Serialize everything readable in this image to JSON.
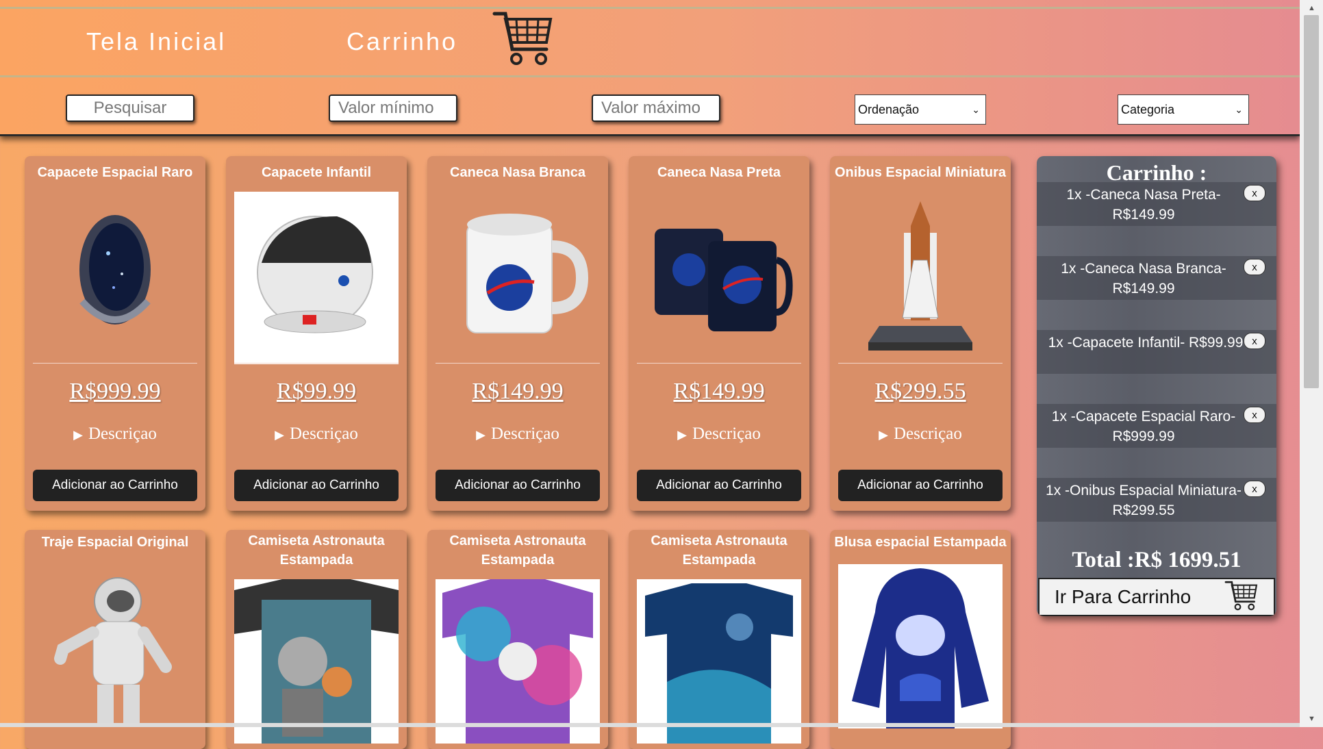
{
  "nav": {
    "home_label": "Tela Inicial",
    "cart_label": "Carrinho"
  },
  "filters": {
    "search_placeholder": "Pesquisar",
    "min_placeholder": "Valor mínimo",
    "max_placeholder": "Valor máximo",
    "sort_selected": "Ordenação",
    "category_selected": "Categoria"
  },
  "products": [
    {
      "name": "Capacete Espacial Raro",
      "price": "R$999.99",
      "description_label": "Descriçao",
      "button_label": "Adicionar ao Carrinho"
    },
    {
      "name": "Capacete Infantil",
      "price": "R$99.99",
      "description_label": "Descriçao",
      "button_label": "Adicionar ao Carrinho"
    },
    {
      "name": "Caneca Nasa Branca",
      "price": "R$149.99",
      "description_label": "Descriçao",
      "button_label": "Adicionar ao Carrinho"
    },
    {
      "name": "Caneca Nasa Preta",
      "price": "R$149.99",
      "description_label": "Descriçao",
      "button_label": "Adicionar ao Carrinho"
    },
    {
      "name": "Onibus Espacial Miniatura",
      "price": "R$299.55",
      "description_label": "Descriçao",
      "button_label": "Adicionar ao Carrinho"
    }
  ],
  "products_row2": [
    {
      "name": "Traje Espacial Original"
    },
    {
      "name": "Camiseta Astronauta Estampada"
    },
    {
      "name": "Camiseta Astronauta Estampada"
    },
    {
      "name": "Camiseta Astronauta Estampada"
    },
    {
      "name": "Blusa espacial Estampada"
    }
  ],
  "cart": {
    "title": "Carrinho :",
    "items": [
      {
        "text": "1x -Caneca Nasa Preta- R$149.99",
        "remove_label": "x"
      },
      {
        "text": "1x -Caneca Nasa Branca- R$149.99",
        "remove_label": "x"
      },
      {
        "text": "1x -Capacete Infantil- R$99.99",
        "remove_label": "x"
      },
      {
        "text": "1x -Capacete Espacial Raro- R$999.99",
        "remove_label": "x"
      },
      {
        "text": "1x -Onibus Espacial Miniatura- R$299.55",
        "remove_label": "x"
      }
    ],
    "total": "Total :R$ 1699.51",
    "go_label": "Ir Para Carrinho"
  }
}
